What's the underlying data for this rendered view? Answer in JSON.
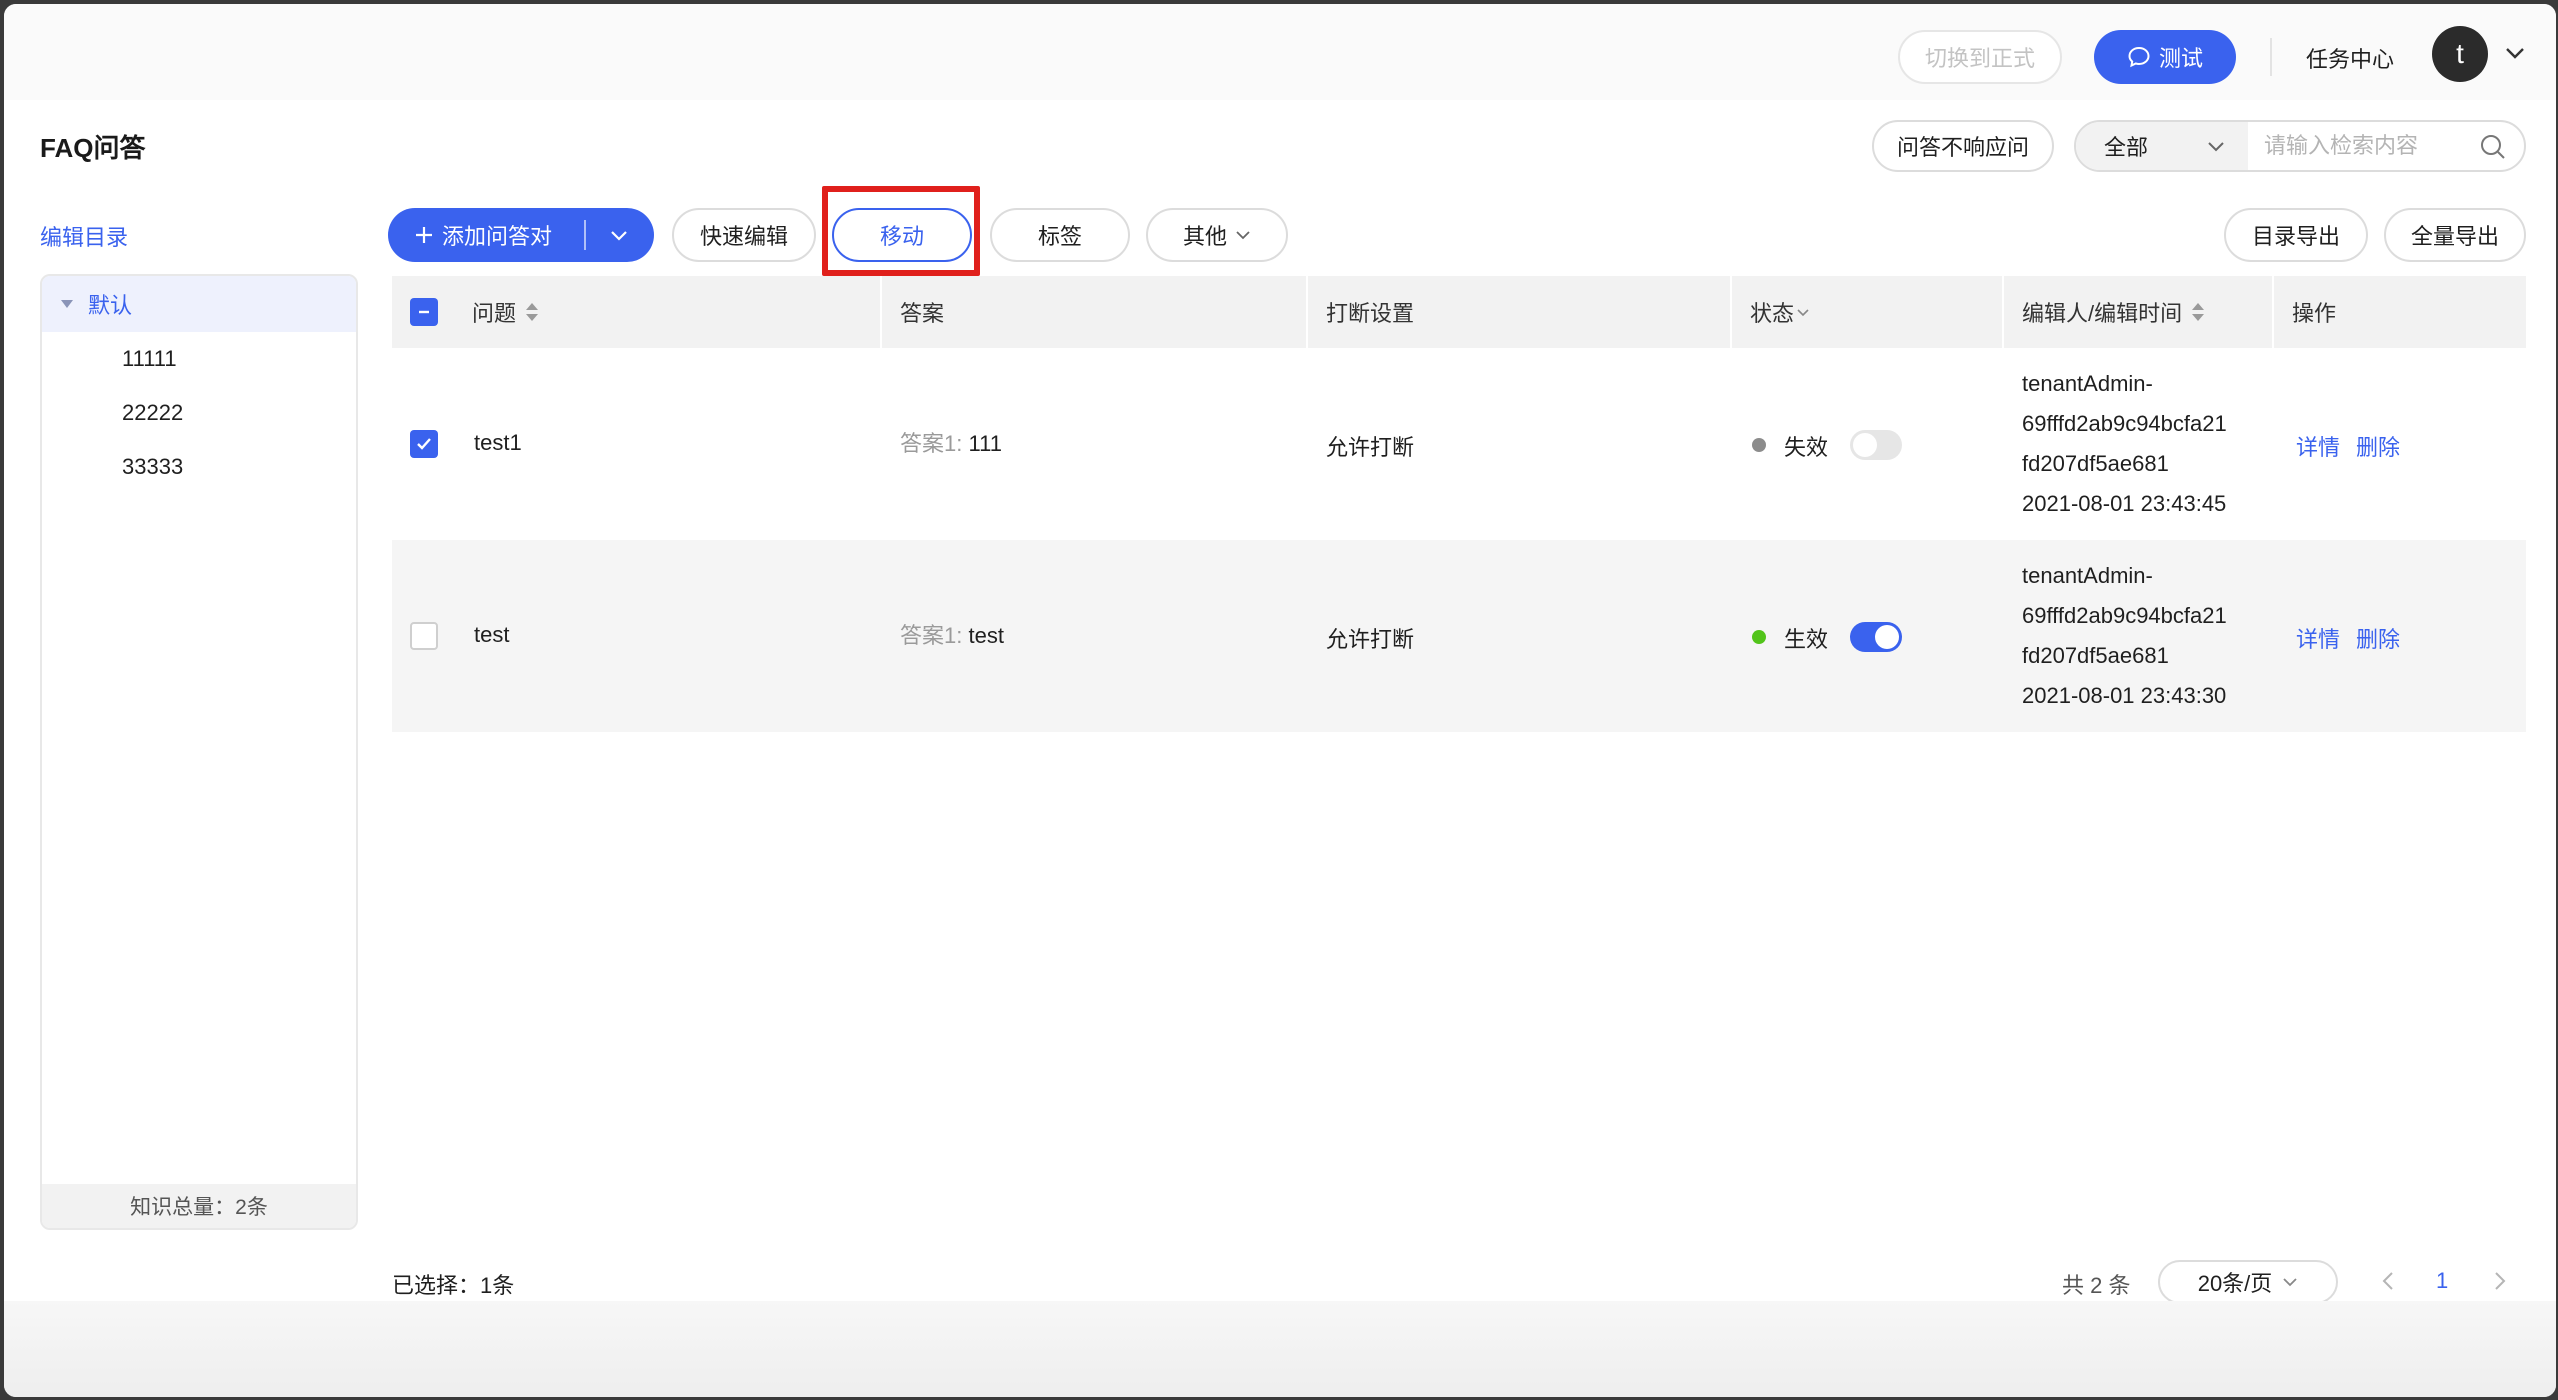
{
  "topbar": {
    "switch_formal": "切换到正式",
    "test_button": "测试",
    "task_center": "任务中心",
    "avatar_letter": "t"
  },
  "header": {
    "title": "FAQ问答",
    "no_answer_button": "问答不响应问",
    "search_scope": "全部",
    "search_placeholder": "请输入检索内容"
  },
  "sidebar": {
    "edit_catalog": "编辑目录",
    "root": "默认",
    "children": [
      "11111",
      "22222",
      "33333"
    ],
    "footer": "知识总量：2条"
  },
  "toolbar": {
    "add_qa": "添加问答对",
    "quick_edit": "快速编辑",
    "move": "移动",
    "tags": "标签",
    "other": "其他",
    "catalog_export": "目录导出",
    "full_export": "全量导出"
  },
  "table": {
    "columns": [
      "问题",
      "答案",
      "打断设置",
      "状态",
      "编辑人/编辑时间",
      "操作"
    ],
    "rows": [
      {
        "checked": true,
        "question": "test1",
        "answer_label": "答案1:",
        "answer": "111",
        "interrupt": "允许打断",
        "status": "失效",
        "status_color": "#8c8c8c",
        "enabled": false,
        "editor_lines": [
          "tenantAdmin-",
          "69fffd2ab9c94bcfa21",
          "fd207df5ae681",
          "2021-08-01 23:43:45"
        ],
        "detail": "详情",
        "delete": "删除"
      },
      {
        "checked": false,
        "question": "test",
        "answer_label": "答案1:",
        "answer": "test",
        "interrupt": "允许打断",
        "status": "生效",
        "status_color": "#52c41a",
        "enabled": true,
        "editor_lines": [
          "tenantAdmin-",
          "69fffd2ab9c94bcfa21",
          "fd207df5ae681",
          "2021-08-01 23:43:30"
        ],
        "detail": "详情",
        "delete": "删除"
      }
    ]
  },
  "footer": {
    "selected": "已选择：1条",
    "total": "共 2 条",
    "page_size": "20条/页",
    "current_page": "1"
  }
}
